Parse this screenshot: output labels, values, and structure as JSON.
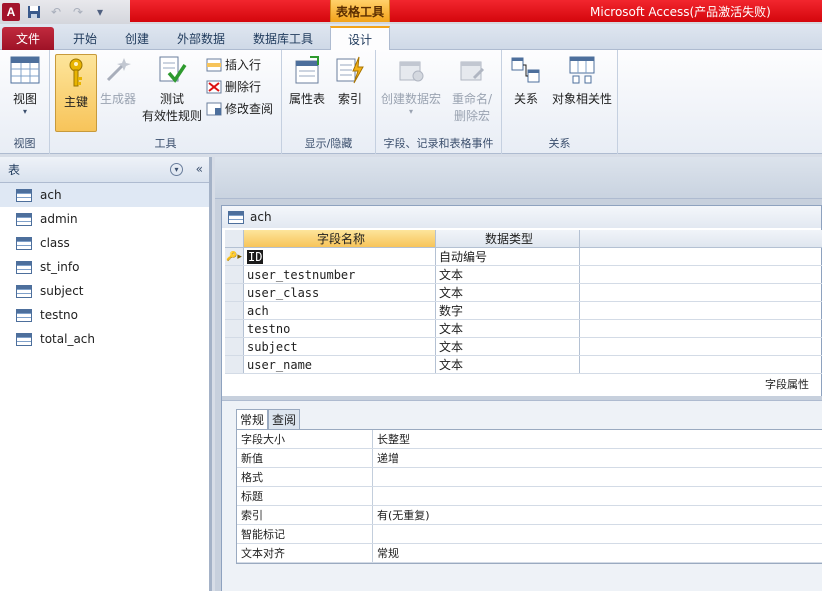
{
  "window": {
    "app_icon_letter": "A",
    "context_tab": "表格工具",
    "title": "Microsoft Access(产品激活失败)"
  },
  "ribbon_tabs": {
    "file": "文件",
    "home": "开始",
    "create": "创建",
    "external": "外部数据",
    "dbtools": "数据库工具",
    "design": "设计"
  },
  "ribbon": {
    "view": {
      "label": "视图",
      "group": "视图"
    },
    "tools": {
      "group": "工具",
      "primary_key": "主键",
      "builder": "生成器",
      "test_rules_line1": "测试",
      "test_rules_line2": "有效性规则",
      "insert_row": "插入行",
      "delete_row": "删除行",
      "modify_lookup": "修改查阅"
    },
    "show_hide": {
      "group": "显示/隐藏",
      "property_sheet": "属性表",
      "indexes": "索引"
    },
    "events": {
      "group": "字段、记录和表格事件",
      "create_macro": "创建数据宏",
      "rename_macro_line1": "重命名/",
      "rename_macro_line2": "删除宏"
    },
    "relationships": {
      "group": "关系",
      "relationships": "关系",
      "dependencies": "对象相关性"
    }
  },
  "nav": {
    "header": "表",
    "items": [
      {
        "label": "ach"
      },
      {
        "label": "admin"
      },
      {
        "label": "class"
      },
      {
        "label": "st_info"
      },
      {
        "label": "subject"
      },
      {
        "label": "testno"
      },
      {
        "label": "total_ach"
      }
    ]
  },
  "document": {
    "title": "ach",
    "col_field_name": "字段名称",
    "col_data_type": "数据类型",
    "fields": [
      {
        "name": "ID",
        "type": "自动编号"
      },
      {
        "name": "user_testnumber",
        "type": "文本"
      },
      {
        "name": "user_class",
        "type": "文本"
      },
      {
        "name": "ach",
        "type": "数字"
      },
      {
        "name": "testno",
        "type": "文本"
      },
      {
        "name": "subject",
        "type": "文本"
      },
      {
        "name": "user_name",
        "type": "文本"
      }
    ],
    "props_caption": "字段属性",
    "prop_tabs": {
      "general": "常规",
      "lookup": "查阅"
    },
    "properties": [
      {
        "label": "字段大小",
        "value": "长整型"
      },
      {
        "label": "新值",
        "value": "递增"
      },
      {
        "label": "格式",
        "value": ""
      },
      {
        "label": "标题",
        "value": ""
      },
      {
        "label": "索引",
        "value": "有(无重复)"
      },
      {
        "label": "智能标记",
        "value": ""
      },
      {
        "label": "文本对齐",
        "value": "常规"
      }
    ]
  }
}
